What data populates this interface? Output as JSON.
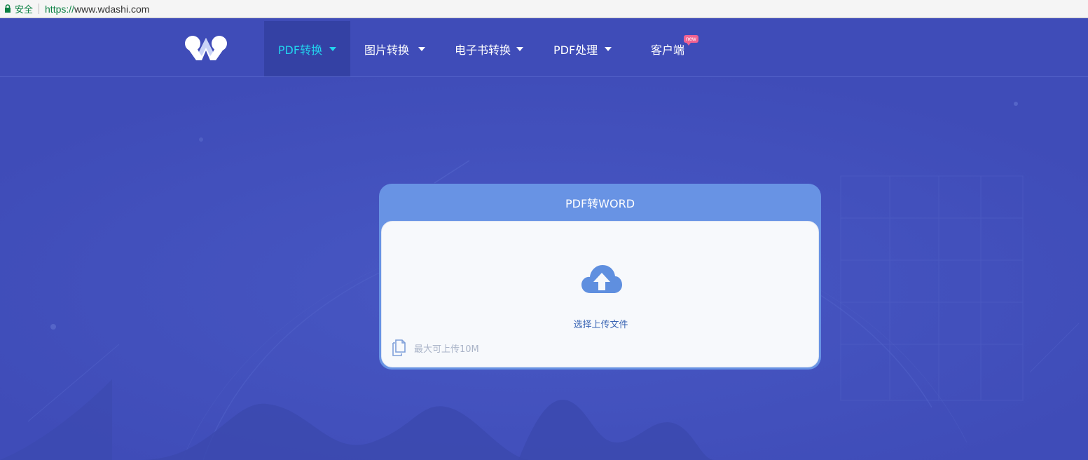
{
  "browser": {
    "secure_label": "安全",
    "url_protocol": "https://",
    "url_host": "www.wdashi.com"
  },
  "nav": {
    "items": [
      {
        "label": "PDF转换",
        "active": true
      },
      {
        "label": "图片转换"
      },
      {
        "label": "电子书转换"
      },
      {
        "label": "PDF处理"
      },
      {
        "label": "客户端"
      }
    ],
    "new_badge": "new"
  },
  "card": {
    "title": "PDF转WORD",
    "upload_label": "选择上传文件",
    "size_limit": "最大可上传10M"
  },
  "icons": {
    "lock": "lock-icon",
    "logo": "wdashi-logo",
    "upload": "cloud-upload-icon",
    "file": "file-copy-icon"
  },
  "colors": {
    "nav_bg": "#3f4cb8",
    "active_text": "#22d4ee",
    "card_header": "#6893e4",
    "upload_text": "#3a65b4",
    "badge": "#f06292"
  }
}
